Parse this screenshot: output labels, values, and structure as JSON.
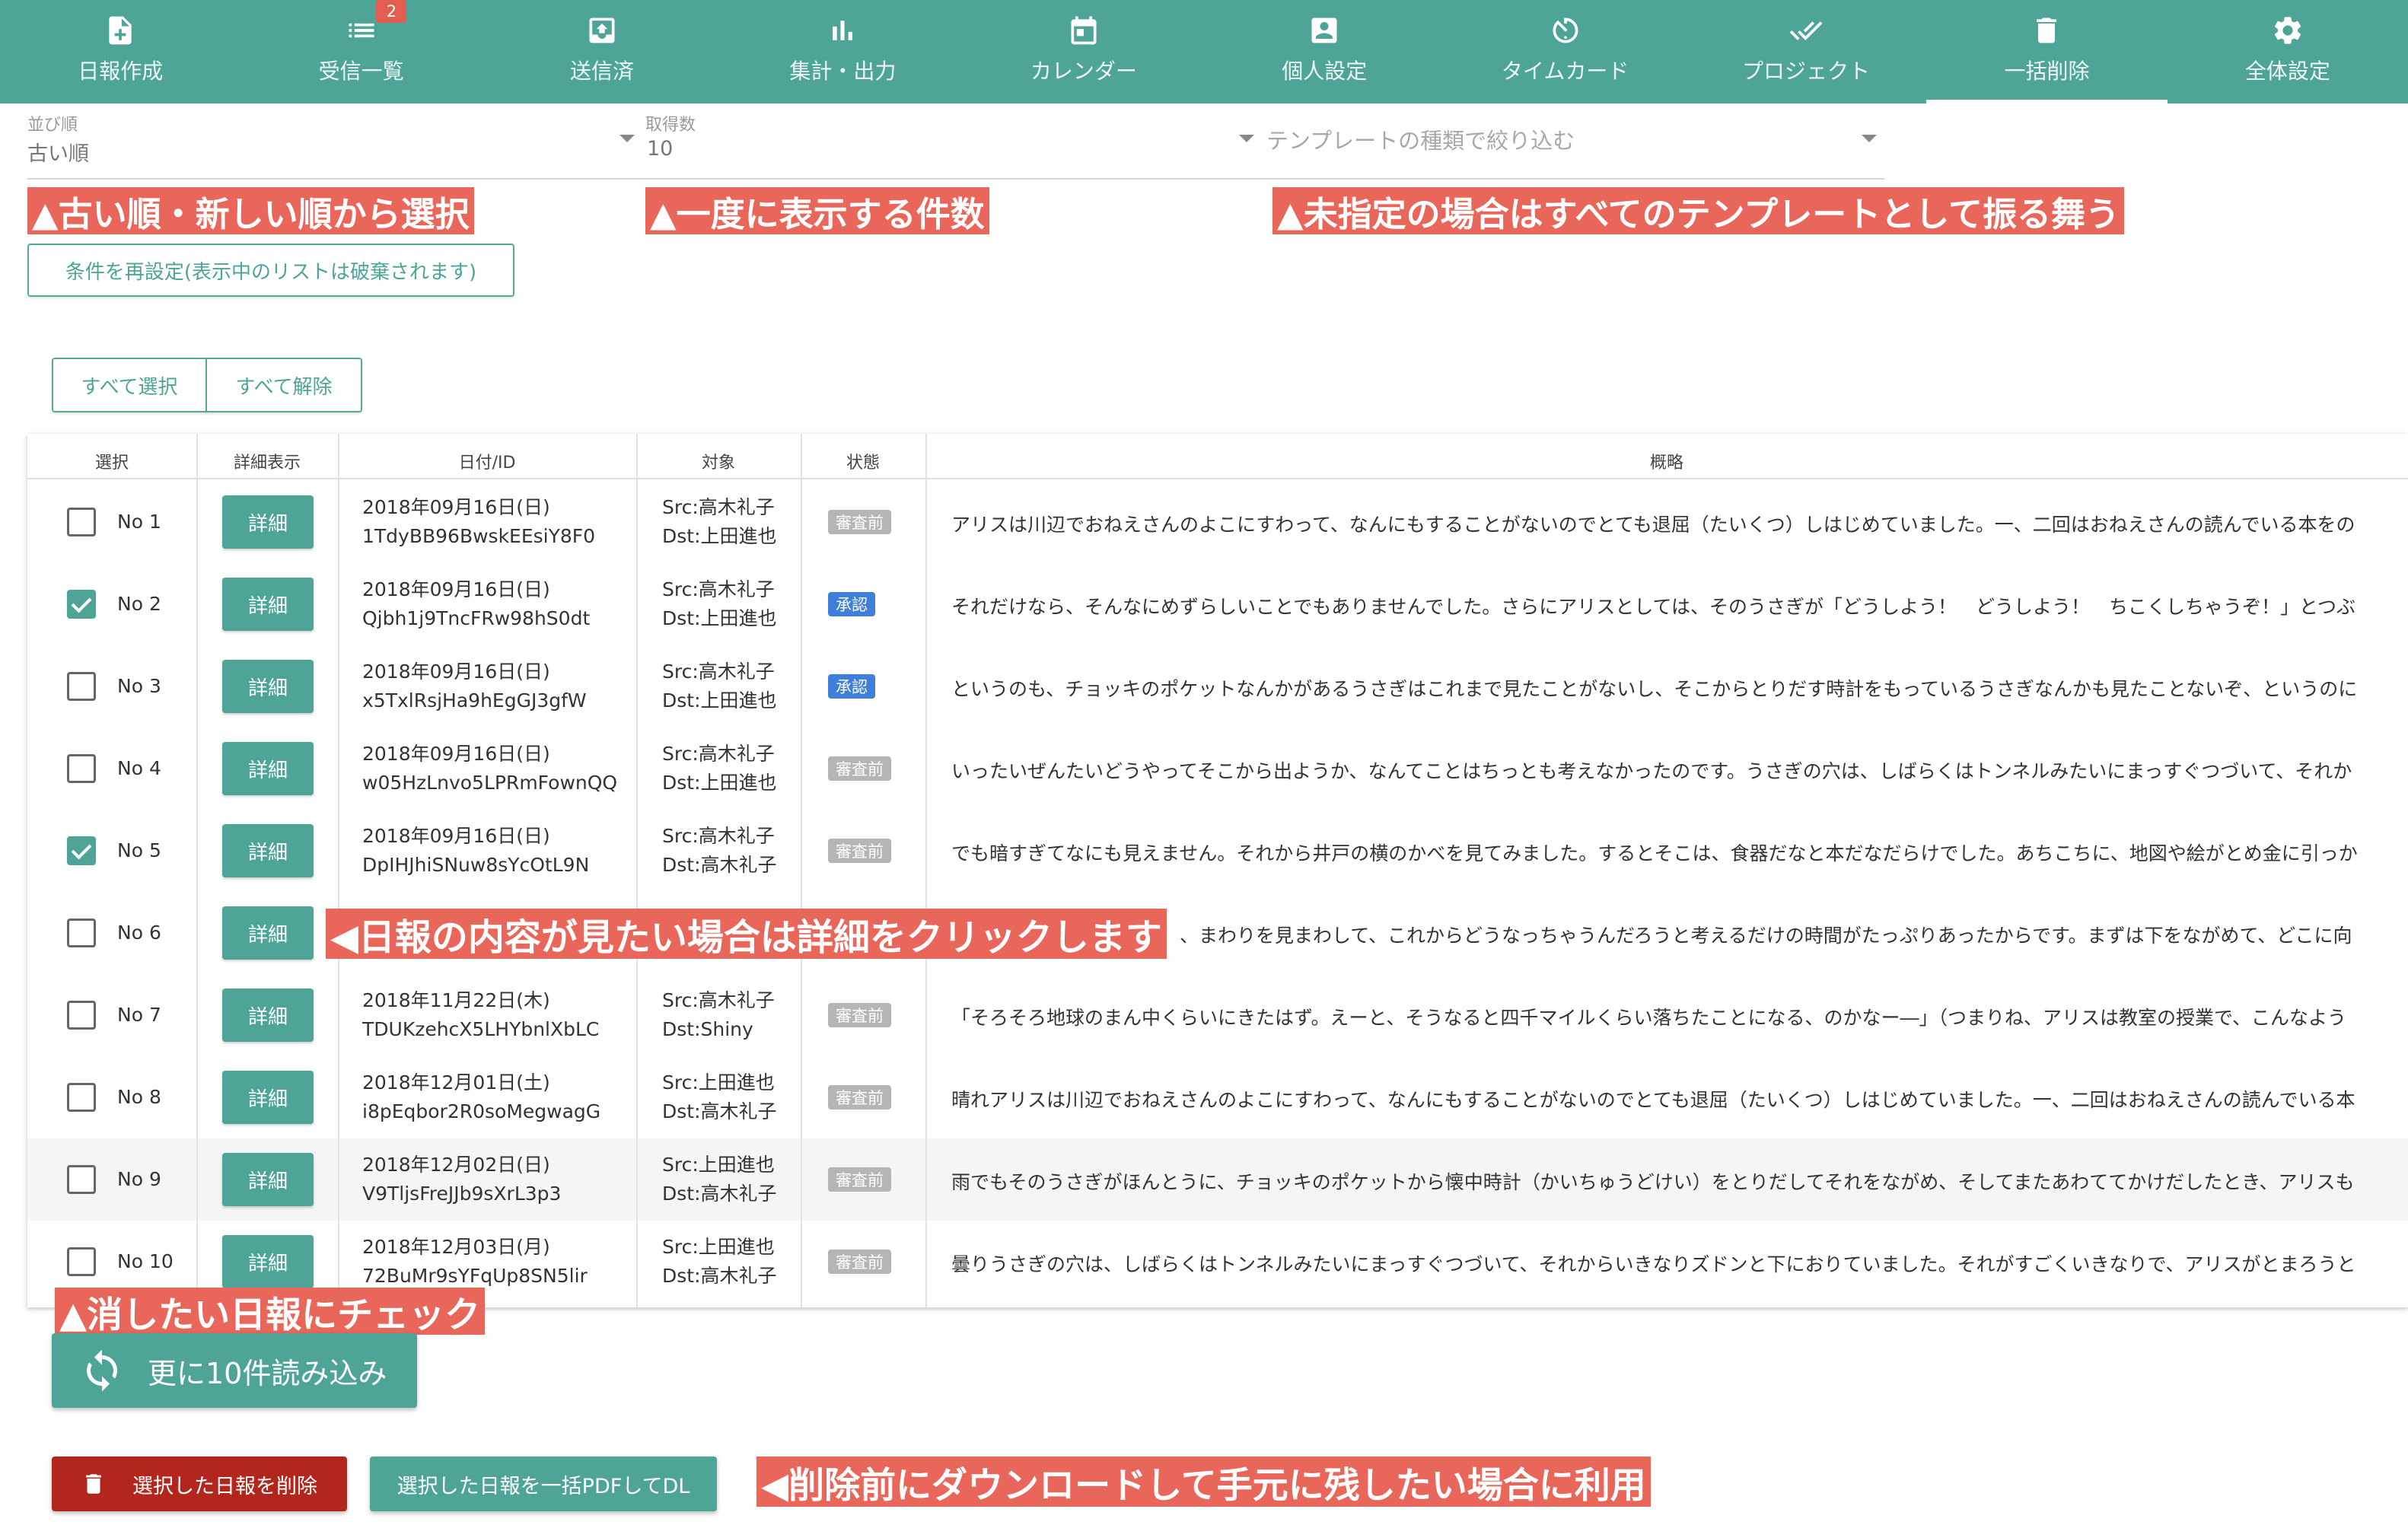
{
  "nav": {
    "items": [
      {
        "label": "日報作成",
        "icon": "file-plus-icon"
      },
      {
        "label": "受信一覧",
        "icon": "list-icon",
        "badge": "2"
      },
      {
        "label": "送信済",
        "icon": "outbox-icon"
      },
      {
        "label": "集計・出力",
        "icon": "bar-chart-icon"
      },
      {
        "label": "カレンダー",
        "icon": "calendar-icon"
      },
      {
        "label": "個人設定",
        "icon": "account-box-icon"
      },
      {
        "label": "タイムカード",
        "icon": "timer-icon"
      },
      {
        "label": "プロジェクト",
        "icon": "double-check-icon"
      },
      {
        "label": "一括削除",
        "icon": "trash-icon",
        "active": true
      },
      {
        "label": "全体設定",
        "icon": "gear-icon"
      }
    ]
  },
  "filters": {
    "sort_label": "並び順",
    "sort_value": "古い順",
    "count_label": "取得数",
    "count_value": "10",
    "template_placeholder": "テンプレートの種類で絞り込む",
    "reset_button": "条件を再設定(表示中のリストは破棄されます)"
  },
  "annotations": {
    "sort": "▲古い順・新しい順から選択",
    "count": "▲一度に表示する件数",
    "template": "▲未指定の場合はすべてのテンプレートとして振る舞う",
    "detail": "◀日報の内容が見たい場合は詳細をクリックします",
    "check": "▲消したい日報にチェック",
    "pdf": "◀削除前にダウンロードして手元に残したい場合に利用"
  },
  "select_buttons": {
    "select_all": "すべて選択",
    "deselect_all": "すべて解除"
  },
  "table": {
    "headers": {
      "select": "選択",
      "detail": "詳細表示",
      "date_id": "日付/ID",
      "target": "対象",
      "status": "状態",
      "summary": "概略"
    },
    "detail_label": "詳細",
    "rows": [
      {
        "no": "No 1",
        "checked": false,
        "date": "2018年09月16日(日)",
        "id": "1TdyBB96BwskEEsiY8F0",
        "src": "Src:高木礼子",
        "dst": "Dst:上田進也",
        "status": "審査前",
        "status_type": "pending",
        "summary": "アリスは川辺でおねえさんのよこにすわって、なんにもすることがないのでとても退屈（たいくつ）しはじめていました。一、二回はおねえさんの読んでいる本をの"
      },
      {
        "no": "No 2",
        "checked": true,
        "date": "2018年09月16日(日)",
        "id": "Qjbh1j9TncFRw98hS0dt",
        "src": "Src:高木礼子",
        "dst": "Dst:上田進也",
        "status": "承認",
        "status_type": "approved",
        "summary": "それだけなら、そんなにめずらしいことでもありませんでした。さらにアリスとしては、そのうさぎが「どうしよう！　どうしよう！　ちこくしちゃうぞ！」とつぶ"
      },
      {
        "no": "No 3",
        "checked": false,
        "date": "2018年09月16日(日)",
        "id": "x5TxlRsjHa9hEgGJ3gfW",
        "src": "Src:高木礼子",
        "dst": "Dst:上田進也",
        "status": "承認",
        "status_type": "approved",
        "summary": "というのも、チョッキのポケットなんかがあるうさぎはこれまで見たことがないし、そこからとりだす時計をもっているうさぎなんかも見たことないぞ、というのに"
      },
      {
        "no": "No 4",
        "checked": false,
        "date": "2018年09月16日(日)",
        "id": "w05HzLnvo5LPRmFownQQ",
        "src": "Src:高木礼子",
        "dst": "Dst:上田進也",
        "status": "審査前",
        "status_type": "pending",
        "summary": "いったいぜんたいどうやってそこから出ようか、なんてことはちっとも考えなかったのです。うさぎの穴は、しばらくはトンネルみたいにまっすぐつづいて、それか"
      },
      {
        "no": "No 5",
        "checked": true,
        "date": "2018年09月16日(日)",
        "id": "DpIHJhiSNuw8sYcOtL9N",
        "src": "Src:高木礼子",
        "dst": "Dst:高木礼子",
        "status": "審査前",
        "status_type": "pending",
        "summary": "でも暗すぎてなにも見えません。それから井戸の横のかべを見てみました。するとそこは、食器だなと本だなだらけでした。あちこちに、地図や絵がとめ金に引っか"
      },
      {
        "no": "No 6",
        "checked": false,
        "date": "",
        "id": "",
        "src": "",
        "dst": "",
        "status": "",
        "status_type": "",
        "summary": "、まわりを見まわして、これからどうなっちゃうんだろうと考えるだけの時間がたっぷりあったからです。まずは下をながめて、どこに向"
      },
      {
        "no": "No 7",
        "checked": false,
        "date": "2018年11月22日(木)",
        "id": "TDUKzehcX5LHYbnlXbLC",
        "src": "Src:高木礼子",
        "dst": "Dst:Shiny",
        "status": "審査前",
        "status_type": "pending",
        "summary": "「そろそろ地球のまん中くらいにきたはず。えーと、そうなると四千マイルくらい落ちたことになる、のかなー―」（つまりね、アリスは教室の授業で、こんなよう"
      },
      {
        "no": "No 8",
        "checked": false,
        "date": "2018年12月01日(土)",
        "id": "i8pEqbor2R0soMegwagG",
        "src": "Src:上田進也",
        "dst": "Dst:高木礼子",
        "status": "審査前",
        "status_type": "pending",
        "summary": "晴れアリスは川辺でおねえさんのよこにすわって、なんにもすることがないのでとても退屈（たいくつ）しはじめていました。一、二回はおねえさんの読んでいる本"
      },
      {
        "no": "No 9",
        "checked": false,
        "date": "2018年12月02日(日)",
        "id": "V9TljsFreJJb9sXrL3p3",
        "src": "Src:上田進也",
        "dst": "Dst:高木礼子",
        "status": "審査前",
        "status_type": "pending",
        "summary": "雨でもそのうさぎがほんとうに、チョッキのポケットから懐中時計（かいちゅうどけい）をとりだしてそれをながめ、そしてまたあわててかけだしたとき、アリスも"
      },
      {
        "no": "No 10",
        "checked": false,
        "date": "2018年12月03日(月)",
        "id": "72BuMr9sYFqUp8SN5lir",
        "src": "Src:上田進也",
        "dst": "Dst:高木礼子",
        "status": "審査前",
        "status_type": "pending",
        "summary": "曇りうさぎの穴は、しばらくはトンネルみたいにまっすぐつづいて、それからいきなりズドンと下におりていました。それがすごくいきなりで、アリスがとまろうと"
      }
    ]
  },
  "actions": {
    "load_more": "更に10件読み込み",
    "delete_selected": "選択した日報を削除",
    "download_pdf": "選択した日報を一括PDFしてDL"
  },
  "colors": {
    "primary": "#4ea597",
    "danger": "#b3261e",
    "annotation": "#e8665a",
    "approved": "#3f7fd9",
    "pending": "#b5b5b5"
  }
}
